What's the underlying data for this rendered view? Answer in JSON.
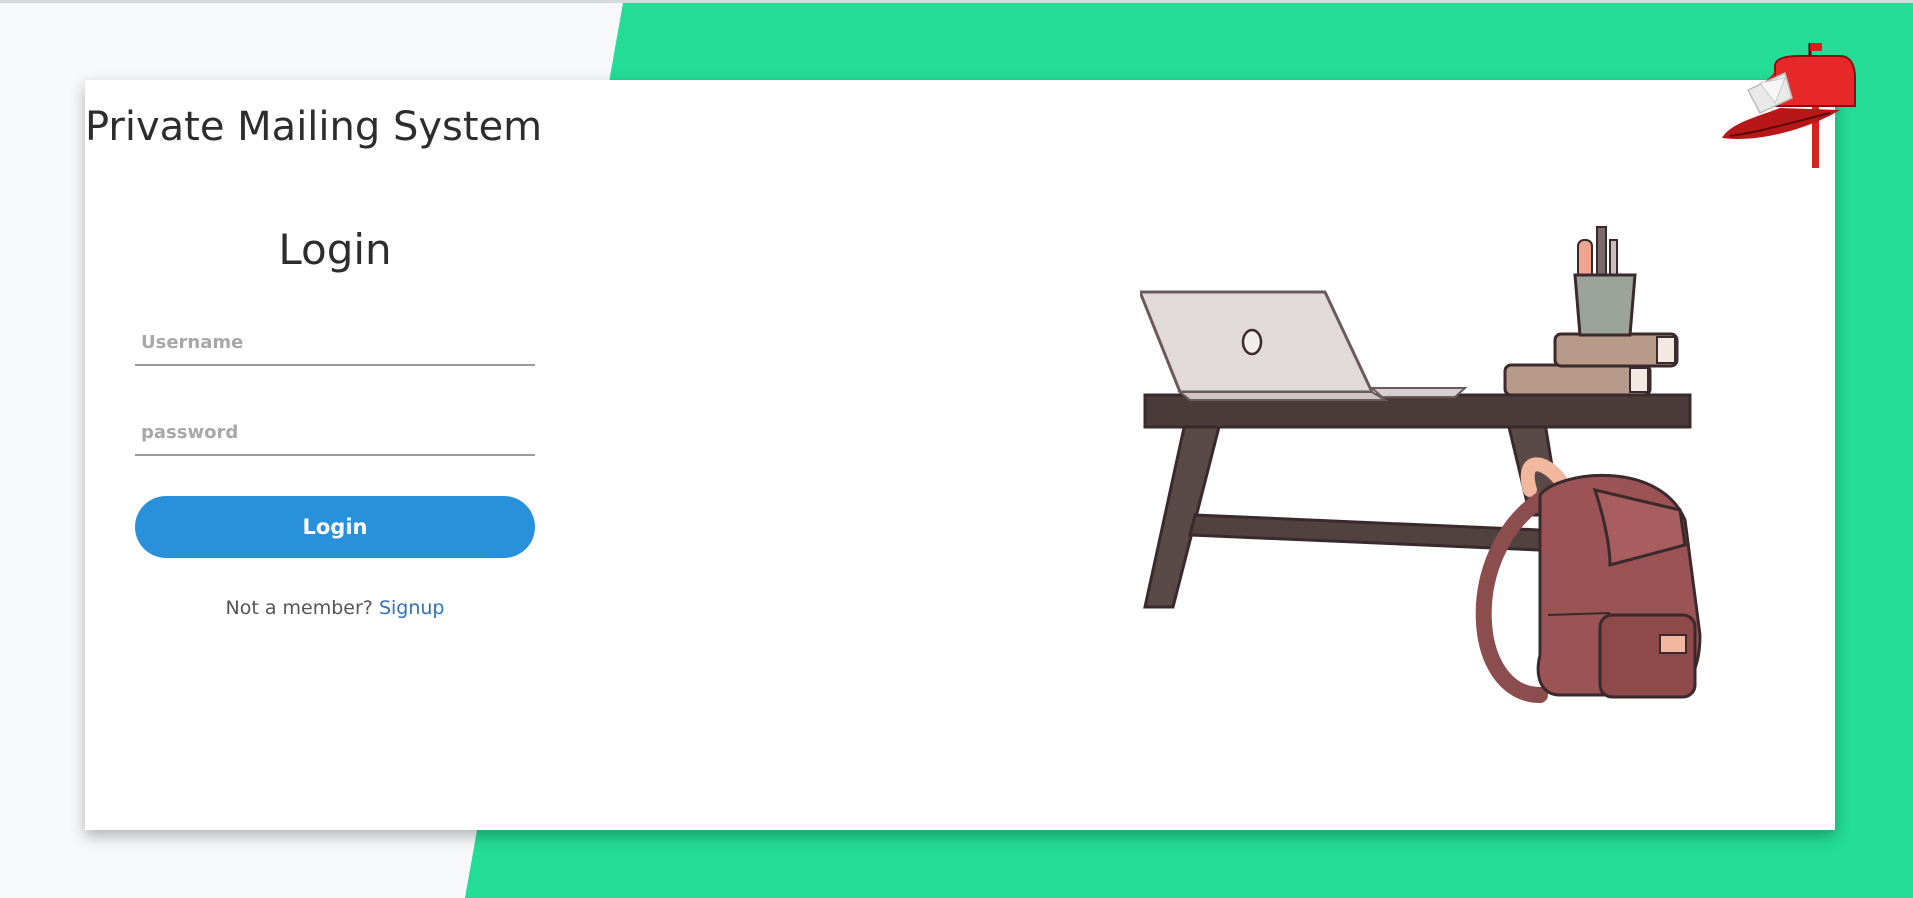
{
  "app": {
    "title": "Private Mailing System"
  },
  "login_form": {
    "heading": "Login",
    "username_placeholder": "Username",
    "password_placeholder": "password",
    "submit_label": "Login",
    "signup_prompt": "Not a member?",
    "signup_link_label": "Signup"
  },
  "colors": {
    "accent_green": "#23dc96",
    "button_blue": "#2990dc",
    "link_blue": "#2f72b8",
    "background_gray": "#f7f8fa"
  },
  "icons": {
    "logo": "mailbox-icon",
    "illustration": "desk-laptop-books-backpack"
  }
}
